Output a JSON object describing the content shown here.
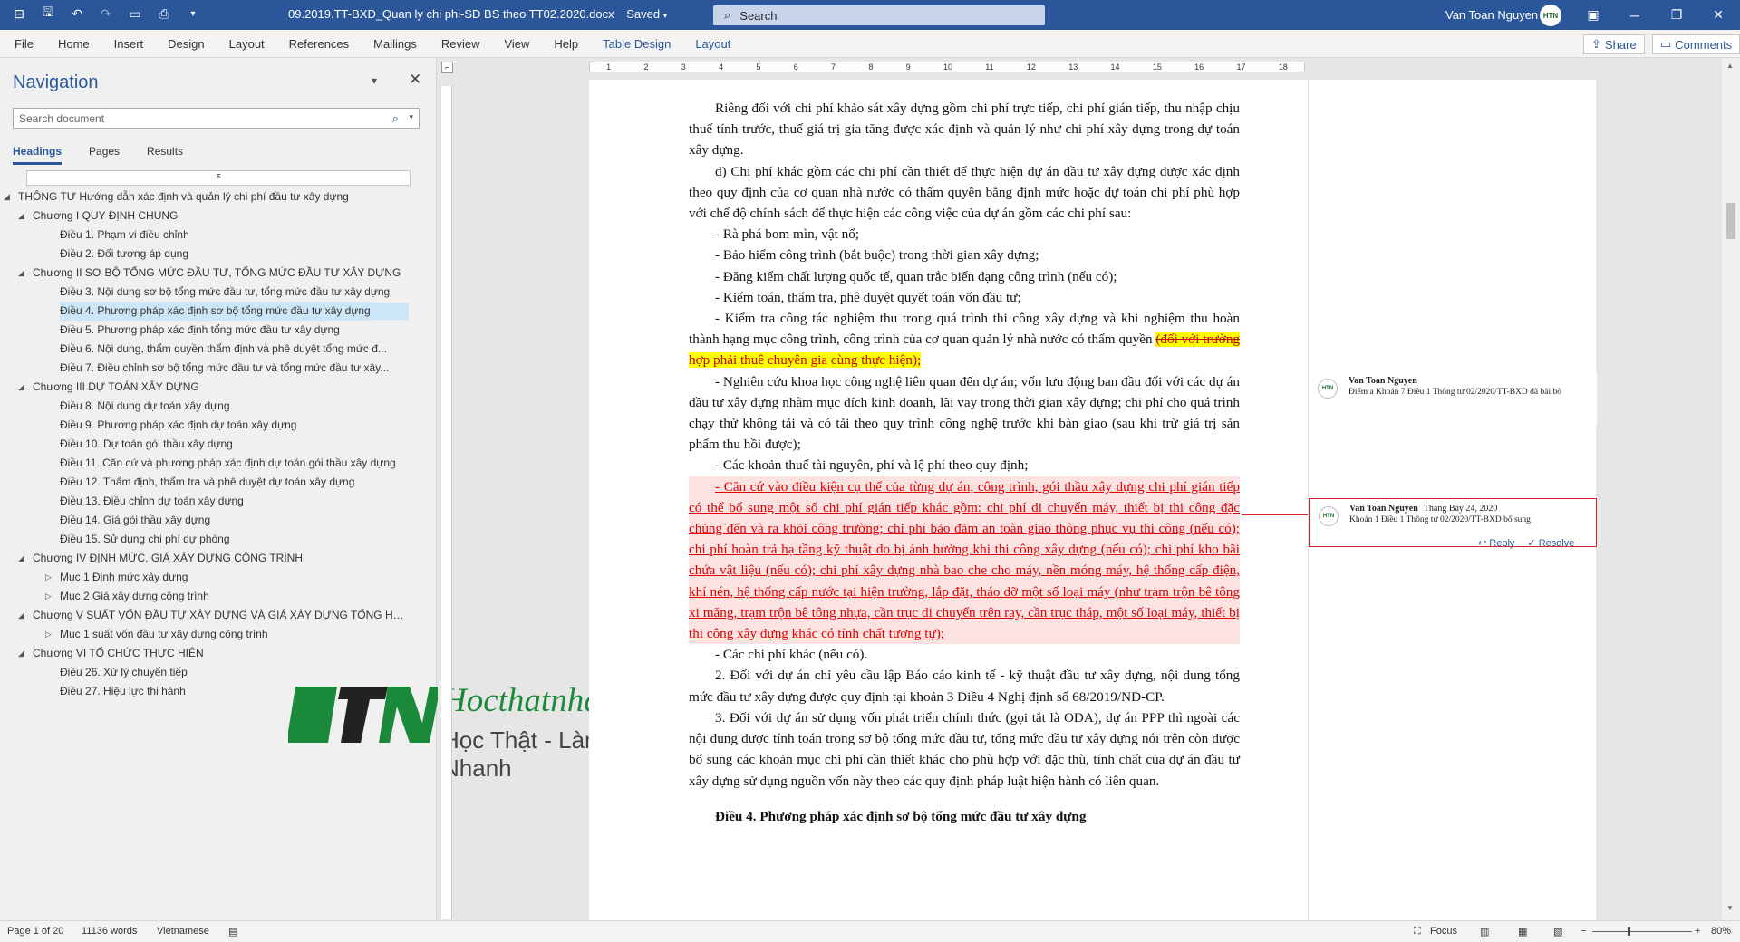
{
  "titlebar": {
    "doc_title": "09.2019.TT-BXD_Quan ly chi phi-SD BS theo TT02.2020.docx",
    "saved": "Saved",
    "search_placeholder": "Search",
    "user_name": "Van Toan Nguyen",
    "avatar_text": "HTN"
  },
  "ribbon": {
    "tabs": [
      "File",
      "Home",
      "Insert",
      "Design",
      "Layout",
      "References",
      "Mailings",
      "Review",
      "View",
      "Help",
      "Table Design",
      "Layout"
    ],
    "share": "Share",
    "comments": "Comments"
  },
  "navigation": {
    "title": "Navigation",
    "search_placeholder": "Search document",
    "tabs": [
      "Headings",
      "Pages",
      "Results"
    ],
    "items": [
      {
        "level": 1,
        "expanded": true,
        "text": "THÔNG TƯ Hướng dẫn xác định và quản lý chi phí đầu tư xây dựng"
      },
      {
        "level": 2,
        "expanded": true,
        "text": "Chương I QUY ĐỊNH CHUNG"
      },
      {
        "level": 3,
        "text": "Điều 1. Phạm vi điều chỉnh"
      },
      {
        "level": 3,
        "text": "Điều 2. Đối tượng áp dụng"
      },
      {
        "level": 2,
        "expanded": true,
        "text": "Chương II SƠ BỘ TỔNG MỨC ĐẦU TƯ, TỔNG MỨC ĐẦU TƯ XÂY DỰNG"
      },
      {
        "level": 3,
        "text": "Điều 3. Nội dung sơ bộ tổng mức đầu tư, tổng mức đầu tư xây dựng"
      },
      {
        "level": 3,
        "text": "Điều 4. Phương pháp xác định sơ bộ tổng mức đầu tư xây dựng",
        "selected": true
      },
      {
        "level": 3,
        "text": "Điều 5. Phương pháp xác định tổng mức đầu tư xây dựng"
      },
      {
        "level": 3,
        "text": "Điều 6. Nội dung, thẩm quyền thẩm định và phê duyệt tổng mức đ..."
      },
      {
        "level": 3,
        "text": "Điều 7. Điều chỉnh sơ bộ tổng mức đầu tư và tổng mức đầu tư xây..."
      },
      {
        "level": 2,
        "expanded": true,
        "text": "Chương III DỰ TOÁN XÂY DỰNG"
      },
      {
        "level": 3,
        "text": "Điều 8. Nội dung dự toán xây dựng"
      },
      {
        "level": 3,
        "text": "Điều 9. Phương pháp xác định dự toán xây dựng"
      },
      {
        "level": 3,
        "text": "Điều 10. Dự toán gói thầu xây dựng"
      },
      {
        "level": 3,
        "text": "Điều 11. Căn cứ và phương pháp xác định dự toán gói thầu xây dựng"
      },
      {
        "level": 3,
        "text": "Điều 12. Thẩm định, thẩm tra và phê duyệt dự toán xây dựng"
      },
      {
        "level": 3,
        "text": "Điều 13. Điều chỉnh dự toán xây dựng"
      },
      {
        "level": 3,
        "text": "Điều 14. Giá gói thầu xây dựng"
      },
      {
        "level": 3,
        "text": "Điều 15. Sử dụng chi phí dự phòng"
      },
      {
        "level": 2,
        "expanded": true,
        "text": "Chương IV ĐỊNH MỨC, GIÁ XÂY DỰNG CÔNG TRÌNH"
      },
      {
        "level": 3,
        "collapsed": true,
        "text": "Mục 1 Định mức xây dựng"
      },
      {
        "level": 3,
        "collapsed": true,
        "text": "Mục 2 Giá xây dựng công trình"
      },
      {
        "level": 2,
        "expanded": true,
        "text": "Chương V SUẤT VỐN ĐẦU TƯ XÂY DỰNG VÀ GIÁ XÂY DỰNG TỔNG HỢP B..."
      },
      {
        "level": 3,
        "collapsed": true,
        "text": "Mục 1 suất vốn đầu tư xây dựng công trình"
      },
      {
        "level": 2,
        "expanded": true,
        "text": "Chương VI TỔ CHỨC THỰC HIỆN"
      },
      {
        "level": 3,
        "text": "Điều 26. Xử lý chuyển tiếp"
      },
      {
        "level": 3,
        "text": "Điều 27. Hiệu lực thi hành"
      }
    ]
  },
  "logo": {
    "mark": "HTN",
    "site": "Hocthatnhanh.vn",
    "slogan": "Học Thật - Làm Nhanh"
  },
  "document": {
    "p1": "Riêng đối với chi phí khảo sát xây dựng gồm chi phí trực tiếp, chi phí gián tiếp, thu nhập chịu thuế tính trước, thuế giá trị gia tăng được xác định và quản lý như chi phí xây dựng trong dự toán xây dựng.",
    "p2": "d) Chi phí khác gồm các chi phí cần thiết để thực hiện dự án đầu tư xây dựng được xác định theo quy định của cơ quan nhà nước có thẩm quyền bằng định mức hoặc dự toán chi phí phù hợp với chế độ chính sách để thực hiện các công việc của dự án gồm các chi phí sau:",
    "b1": "- Rà phá bom mìn, vật nổ;",
    "b2": "- Bảo hiểm công trình (bắt buộc) trong thời gian xây dựng;",
    "b3": "- Đăng kiểm chất lượng quốc tế, quan trắc biến dạng công trình (nếu có);",
    "b4": "- Kiểm toán, thẩm tra, phê duyệt quyết toán vốn đầu tư;",
    "b5_pre": "- Kiểm tra công tác nghiệm thu trong quá trình thi công xây dựng và khi nghiệm thu hoàn thành hạng mục công trình, công trình của cơ quan quản lý nhà nước có thẩm quyền ",
    "b5_deleted": "(đối với trường hợp phải thuê chuyên gia cùng thực hiện);",
    "b6": "- Nghiên cứu khoa học công nghệ liên quan đến dự án; vốn lưu động ban đầu đối với các dự án đầu tư xây dựng nhằm mục đích kinh doanh, lãi vay trong thời gian xây dựng; chi phí cho quá trình chạy thử không tải và có tải theo quy trình công nghệ trước khi bàn giao (sau khi trừ giá trị sản phẩm thu hồi được);",
    "b7": "- Các khoản thuế tài nguyên, phí và lệ phí theo quy định;",
    "b8_inserted": "- Căn cứ vào điều kiện cụ thể của từng dự án, công trình, gói thầu xây dựng chi phí gián tiếp có thể bổ sung một số chi phí gián tiếp khác gồm: chi phí di chuyển máy, thiết bị thi công đặc chủng đến và ra khỏi công trường; chi phí bảo đảm an toàn giao thông phục vụ thi công (nếu có); chi phí hoàn trả hạ tầng kỹ thuật do bị ảnh hưởng khi thi công xây dựng (nếu có); chi phí kho bãi chứa vật liệu (nếu có); chi phí xây dựng nhà bao che cho máy, nền móng máy, hệ thống cấp điện, khí nén, hệ thống cấp nước tại hiện trường, lắp đặt, tháo dỡ một số loại máy (như trạm trộn bê tông xi măng, trạm trộn bê tông nhựa, cần trục di chuyển trên ray, cần trục tháp, một số loại máy, thiết bị thi công xây dựng khác có tính chất tương tự);",
    "b9": "- Các chi phí khác (nếu có).",
    "p3": "2. Đối với dự án chỉ yêu cầu lập Báo cáo kinh tế - kỹ thuật đầu tư xây dựng, nội dung tổng mức đầu tư xây dựng được quy định tại khoản 3 Điều 4 Nghị định số 68/2019/NĐ-CP.",
    "p4": "3. Đối với dự án sử dụng vốn phát triển chính thức (gọi tắt là ODA), dự án PPP thì ngoài các nội dung được tính toán trong sơ bộ tổng mức đầu tư, tổng mức đầu tư xây dựng nói trên còn được bổ sung các khoản mục chi phí cần thiết khác cho phù hợp với đặc thù, tính chất của dự án đầu tư xây dựng sử dụng nguồn vốn này theo các quy định pháp luật hiện hành có liên quan.",
    "heading": "Điều 4. Phương pháp xác định sơ bộ tổng mức đầu tư xây dựng"
  },
  "comments": [
    {
      "author": "Van Toan Nguyen",
      "date": "",
      "text": "Điểm a Khoản 7 Điều 1 Thông tư 02/2020/TT-BXD đã bãi bỏ"
    },
    {
      "author": "Van Toan Nguyen",
      "date": "Tháng Bảy 24, 2020",
      "text": "Khoản 1 Điều 1 Thông tư 02/2020/TT-BXD bổ sung",
      "reply": "Reply",
      "resolve": "Resolve"
    }
  ],
  "statusbar": {
    "page": "Page 1 of 20",
    "words": "11136 words",
    "language": "Vietnamese",
    "focus": "Focus",
    "zoom": "80%"
  },
  "colors": {
    "brand": "#2b579a",
    "inserted": "#e00000",
    "highlight": "#ffff00",
    "logo_green": "#1a8a3a"
  }
}
